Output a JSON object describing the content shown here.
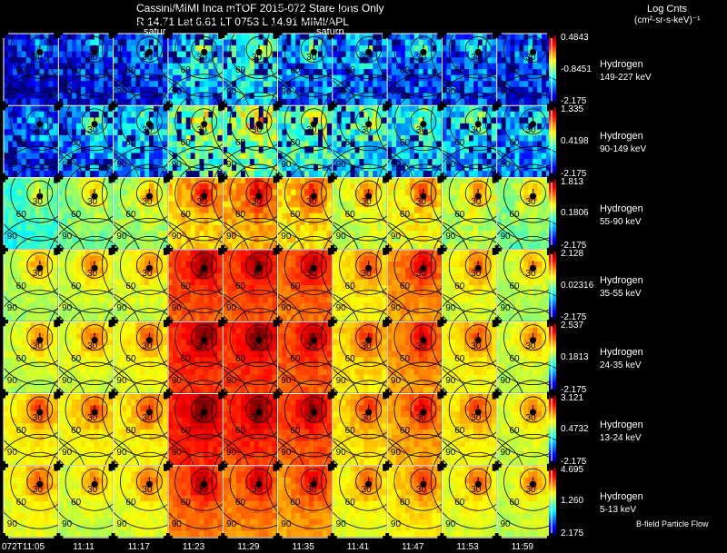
{
  "header": {
    "line1": "Cassini/MIMI Inca mTOF  2015-072   Stare    Ions Only",
    "line2": "R        14.71  Lat 6.61  LT 0753  L        14.91   MIMI/APL",
    "saturn_label_1": "satur",
    "saturn_label_2": "saturn"
  },
  "log_counts": {
    "title": "Log Cnts",
    "units": "(cm²-sr-s-keV)⁻¹"
  },
  "footer_note": "B-field  Particle Flow",
  "times": [
    "072T11:05",
    "11:11",
    "11:17",
    "11:23",
    "11:29",
    "11:35",
    "11:41",
    "11:47",
    "11:53",
    "11:59"
  ],
  "contour_labels": [
    "30",
    "60",
    "90"
  ],
  "colors": {
    "background": "#000000",
    "grid_line": "#ffffff",
    "contour": "#000000"
  },
  "chart_data": {
    "type": "heatmap",
    "description_type": "energetic neutral atom image grid",
    "rows": [
      {
        "species": "Hydrogen",
        "energy": "149-227 keV",
        "cb_max": "0.4843",
        "cb_mid": "-0.8451",
        "cb_min": "-2.175",
        "levels": [
          0.15,
          0.2,
          0.22,
          0.35,
          0.4,
          0.3,
          0.28,
          0.25,
          0.25,
          0.2
        ]
      },
      {
        "species": "Hydrogen",
        "energy": "90-149 keV",
        "cb_max": "1.335",
        "cb_mid": "0.4198",
        "cb_min": "-2.175",
        "levels": [
          0.22,
          0.3,
          0.33,
          0.5,
          0.55,
          0.45,
          0.42,
          0.38,
          0.35,
          0.3
        ]
      },
      {
        "species": "Hydrogen",
        "energy": "55-90 keV",
        "cb_max": "1.813",
        "cb_mid": "0.1806",
        "cb_min": "-2.175",
        "levels": [
          0.47,
          0.55,
          0.58,
          0.72,
          0.75,
          0.7,
          0.62,
          0.66,
          0.6,
          0.55
        ]
      },
      {
        "species": "Hydrogen",
        "energy": "35-55 keV",
        "cb_max": "2.128",
        "cb_mid": "0.02316",
        "cb_min": "-2.175",
        "levels": [
          0.6,
          0.62,
          0.63,
          0.85,
          0.85,
          0.82,
          0.68,
          0.78,
          0.65,
          0.6
        ]
      },
      {
        "species": "Hydrogen",
        "energy": "24-35 keV",
        "cb_max": "2.537",
        "cb_mid": "0.1813",
        "cb_min": "-2.175",
        "levels": [
          0.62,
          0.64,
          0.66,
          0.88,
          0.88,
          0.84,
          0.7,
          0.78,
          0.67,
          0.62
        ]
      },
      {
        "species": "Hydrogen",
        "energy": "13-24 keV",
        "cb_max": "3.121",
        "cb_mid": "0.4732",
        "cb_min": "-2.175",
        "levels": [
          0.68,
          0.67,
          0.68,
          0.9,
          0.88,
          0.85,
          0.7,
          0.76,
          0.68,
          0.63
        ]
      },
      {
        "species": "Hydrogen",
        "energy": "5-13 keV",
        "cb_max": "4.695",
        "cb_mid": "1.260",
        "cb_min": "2.175",
        "levels": [
          0.66,
          0.62,
          0.65,
          0.82,
          0.8,
          0.78,
          0.66,
          0.7,
          0.65,
          0.62
        ]
      }
    ]
  }
}
